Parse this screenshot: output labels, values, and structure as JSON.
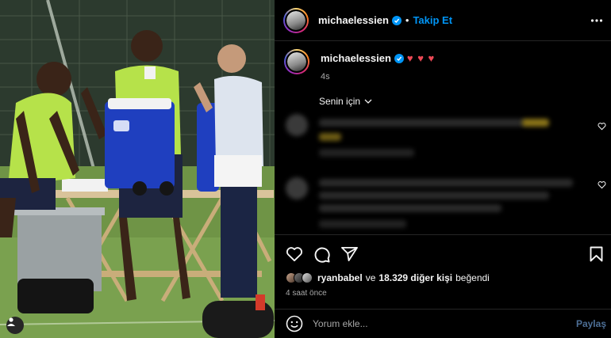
{
  "post": {
    "username": "michaelessien",
    "dot": "•",
    "follow_label": "Takip Et",
    "more_icon": "more-horizontal-icon"
  },
  "caption": {
    "username": "michaelessien",
    "hearts": "♥ ♥ ♥",
    "time": "4s"
  },
  "comments": {
    "sort_label": "Senin için"
  },
  "likes": {
    "liker": "ryanbabel",
    "connector": "ve",
    "count_text": "18.329 diğer kişi",
    "suffix": "beğendi"
  },
  "posted_time": "4 saat önce",
  "comment_box": {
    "placeholder": "Yorum ekle...",
    "post_label": "Paylaş"
  },
  "colors": {
    "accent": "#0095f6",
    "heart": "#ed4956",
    "background": "#000000",
    "divider": "#262626"
  }
}
